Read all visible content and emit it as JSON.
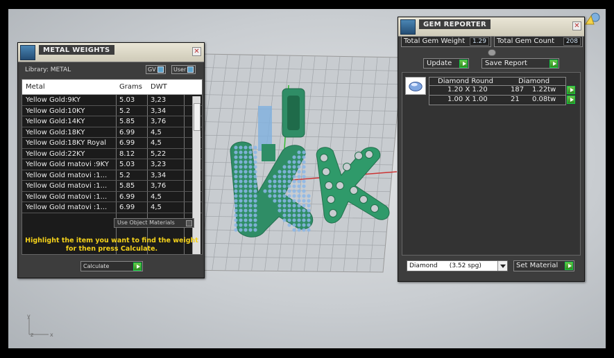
{
  "metal_weights": {
    "title": "METAL WEIGHTS",
    "library_label": "Library: METAL",
    "toggle_gv": "GV",
    "toggle_user": "User",
    "columns": [
      "Metal",
      "Grams",
      "DWT"
    ],
    "rows": [
      [
        "Yellow Gold:9KY",
        "5.03",
        "3,23"
      ],
      [
        "Yellow Gold:10KY",
        "5.2",
        "3,34"
      ],
      [
        "Yellow Gold:14KY",
        "5.85",
        "3,76"
      ],
      [
        "Yellow Gold:18KY",
        "6.99",
        "4,5"
      ],
      [
        "Yellow Gold:18KY Royal",
        "6.99",
        "4,5"
      ],
      [
        "Yellow Gold:22KY",
        "8.12",
        "5,22"
      ],
      [
        "Yellow Gold matovi :9KY",
        "5.03",
        "3,23"
      ],
      [
        "Yellow Gold matovi :1...",
        "5.2",
        "3,34"
      ],
      [
        "Yellow Gold matovi :1...",
        "5.85",
        "3,76"
      ],
      [
        "Yellow Gold matovi :1...",
        "6.99",
        "4,5"
      ],
      [
        "Yellow Gold matovi :1...",
        "6.99",
        "4,5"
      ]
    ],
    "use_object_materials": "Use Object Materials",
    "hint": "Highlight the item you want to find the weight for then press Calculate.",
    "calculate": "Calculate"
  },
  "gem_reporter": {
    "title": "GEM REPORTER",
    "total_weight_label": "Total Gem Weight",
    "total_weight_value": "1.29",
    "total_count_label": "Total Gem Count",
    "total_count_value": "208",
    "update": "Update",
    "save_report": "Save Report",
    "table_head": [
      "Diamond Round",
      "Diamond"
    ],
    "rows": [
      [
        "1.20 X 1.20",
        "187",
        "1.22tw"
      ],
      [
        "1.00 X 1.00",
        "21",
        "0.08tw"
      ]
    ],
    "material_select": "Diamond      (3.52 spg)",
    "set_material": "Set Material"
  },
  "axis": {
    "z": "z",
    "y": "y",
    "x": "x"
  },
  "colors": {
    "accent_green": "#3aa02a",
    "hint_yellow": "#f5d21a",
    "model_green": "#2f9a6a",
    "gem_blue": "#8bb8e8"
  }
}
